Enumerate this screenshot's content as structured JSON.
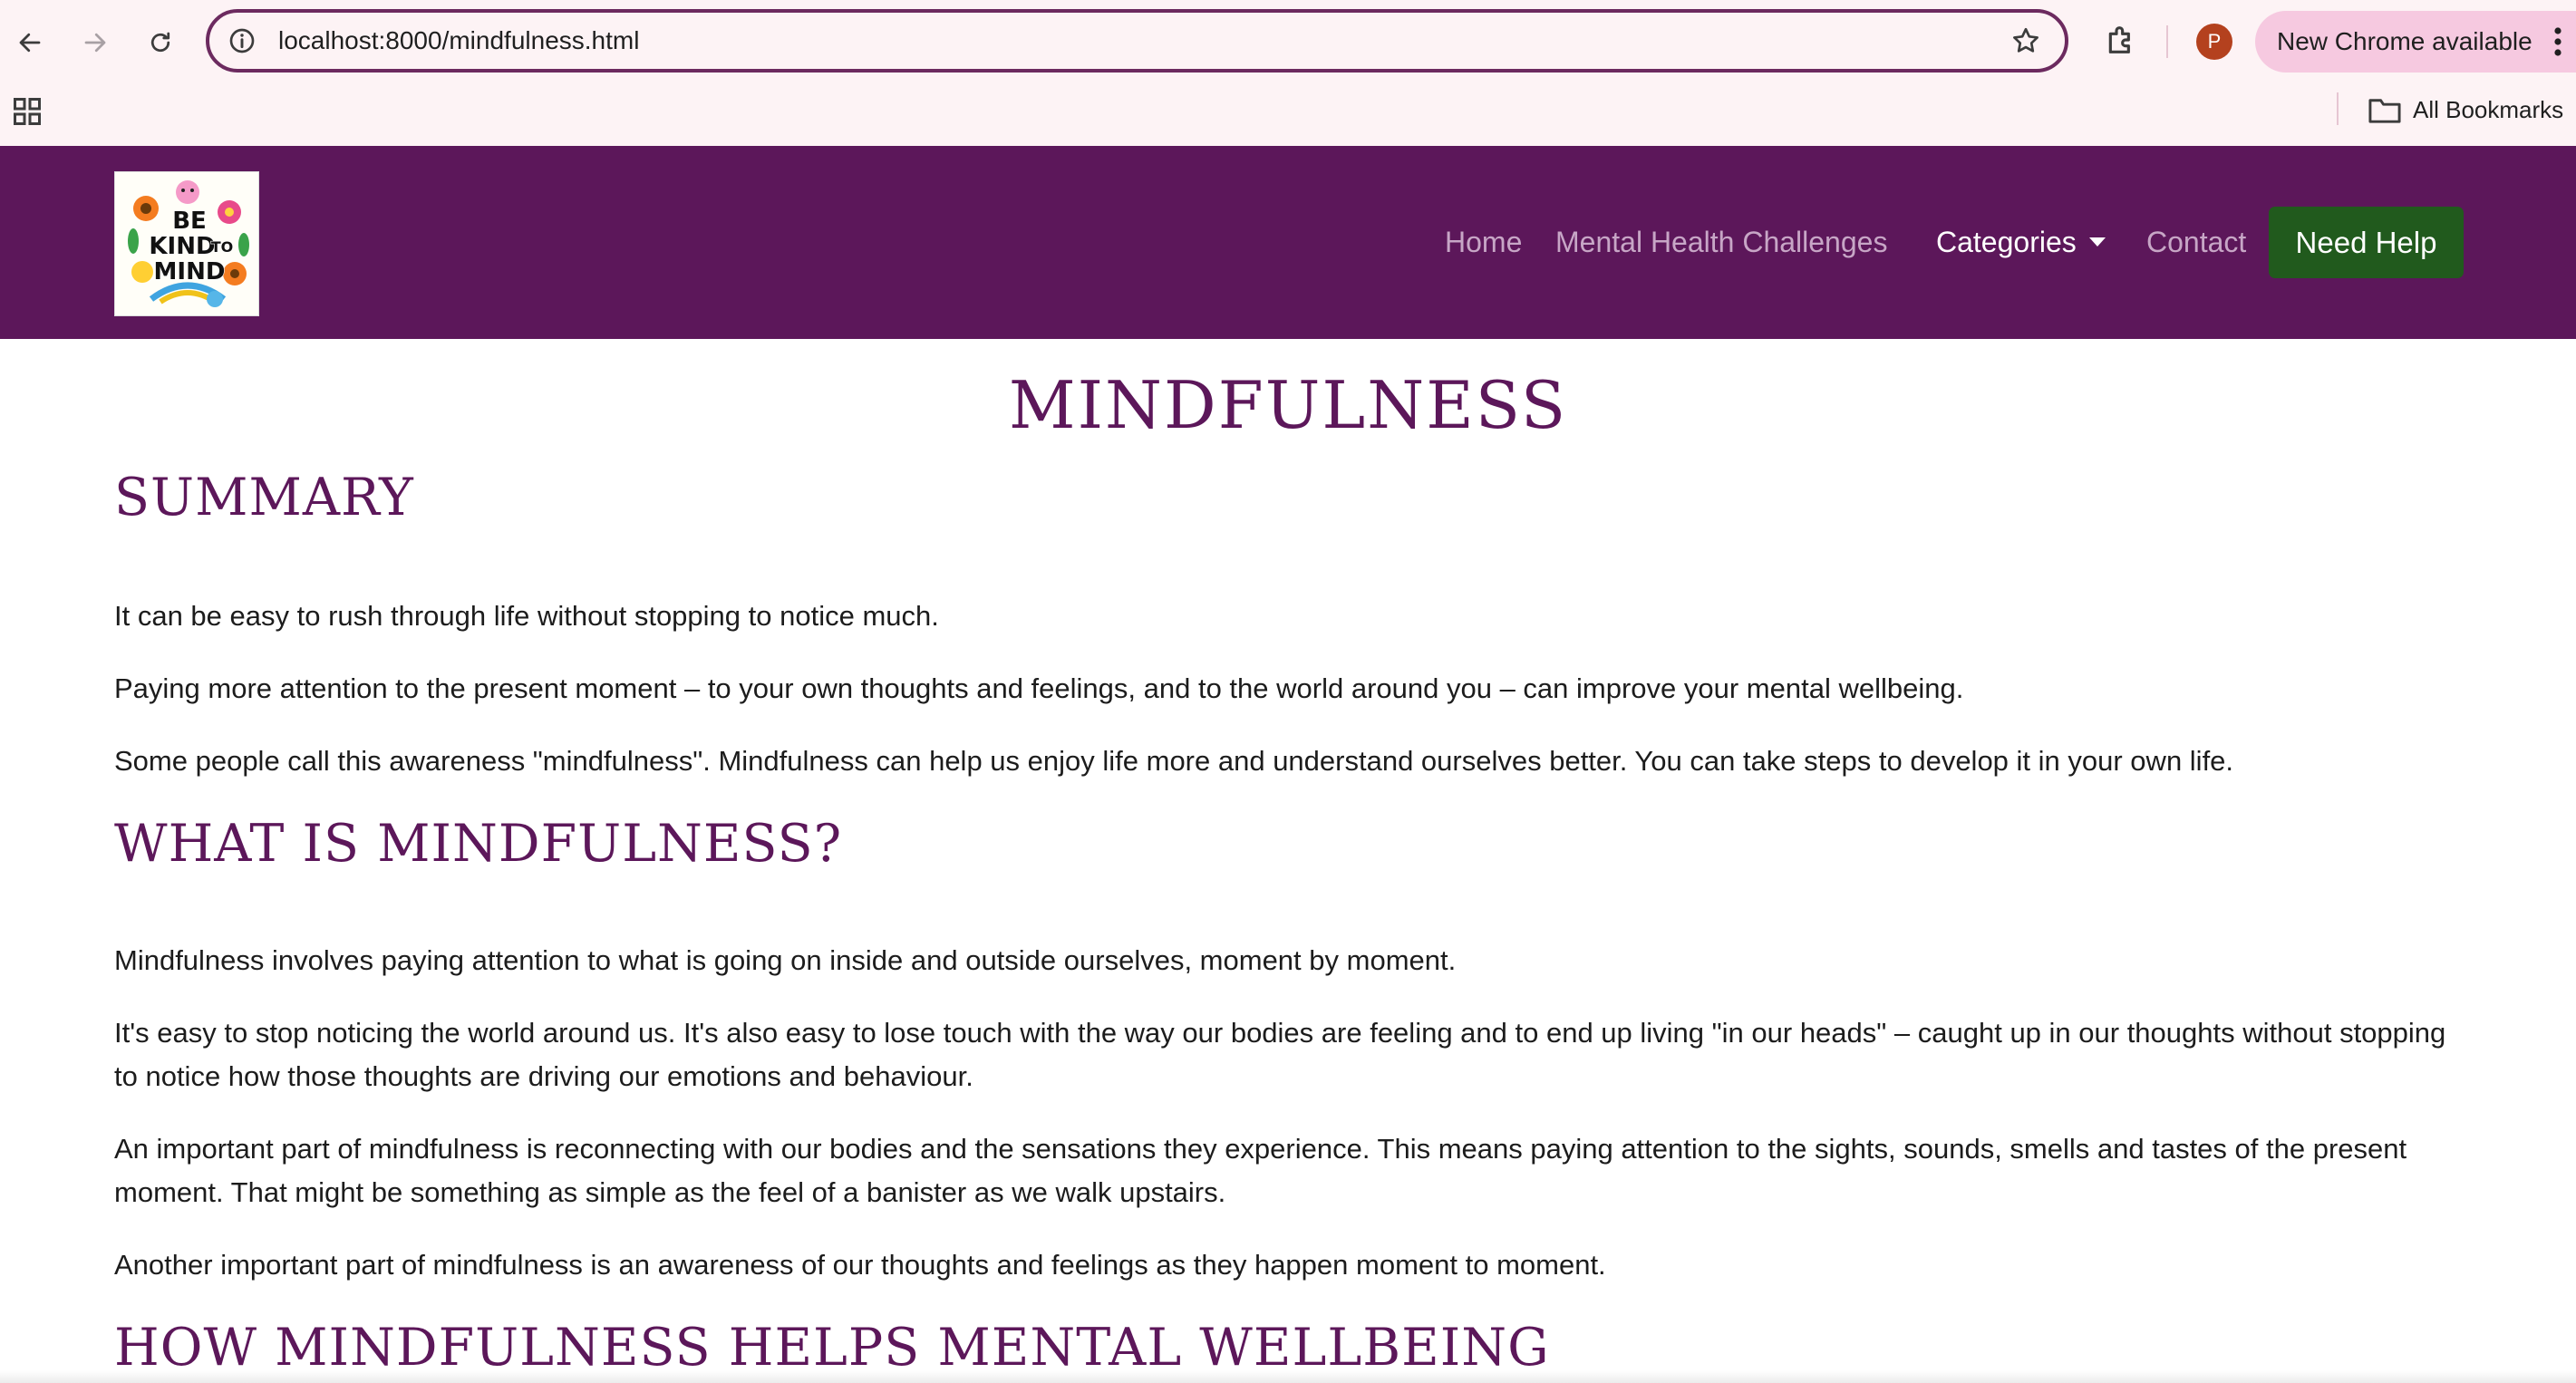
{
  "browser": {
    "url": "localhost:8000/mindfulness.html",
    "profile_initial": "P",
    "update_chip": "New Chrome available",
    "bookmarks_label": "All Bookmarks",
    "icons": [
      "back-icon",
      "forward-icon",
      "reload-icon",
      "site-info-icon",
      "bookmark-star-icon",
      "extensions-icon",
      "apps-grid-icon",
      "folder-icon",
      "kebab-menu-icon"
    ]
  },
  "site": {
    "logo_text": "BE KIND TO YOUR MIND",
    "nav": {
      "home": "Home",
      "challenges": "Mental Health Challenges",
      "categories": "Categories",
      "contact": "Contact",
      "help": "Need Help"
    },
    "colors": {
      "nav_bg": "#5c175a",
      "help_button": "#215a1d",
      "heading": "#5c175a"
    }
  },
  "page": {
    "title": "MINDFULNESS",
    "sections": [
      {
        "heading": "SUMMARY",
        "paragraphs": [
          "It can be easy to rush through life without stopping to notice much.",
          "Paying more attention to the present moment – to your own thoughts and feelings, and to the world around you – can improve your mental wellbeing.",
          "Some people call this awareness \"mindfulness\". Mindfulness can help us enjoy life more and understand ourselves better. You can take steps to develop it in your own life."
        ]
      },
      {
        "heading": "WHAT IS MINDFULNESS?",
        "paragraphs": [
          "Mindfulness involves paying attention to what is going on inside and outside ourselves, moment by moment.",
          "It's easy to stop noticing the world around us. It's also easy to lose touch with the way our bodies are feeling and to end up living \"in our heads\" – caught up in our thoughts without stopping to notice how those thoughts are driving our emotions and behaviour.",
          "An important part of mindfulness is reconnecting with our bodies and the sensations they experience. This means paying attention to the sights, sounds, smells and tastes of the present moment. That might be something as simple as the feel of a banister as we walk upstairs.",
          "Another important part of mindfulness is an awareness of our thoughts and feelings as they happen moment to moment."
        ]
      },
      {
        "heading": "HOW MINDFULNESS HELPS MENTAL WELLBEING"
      }
    ]
  }
}
